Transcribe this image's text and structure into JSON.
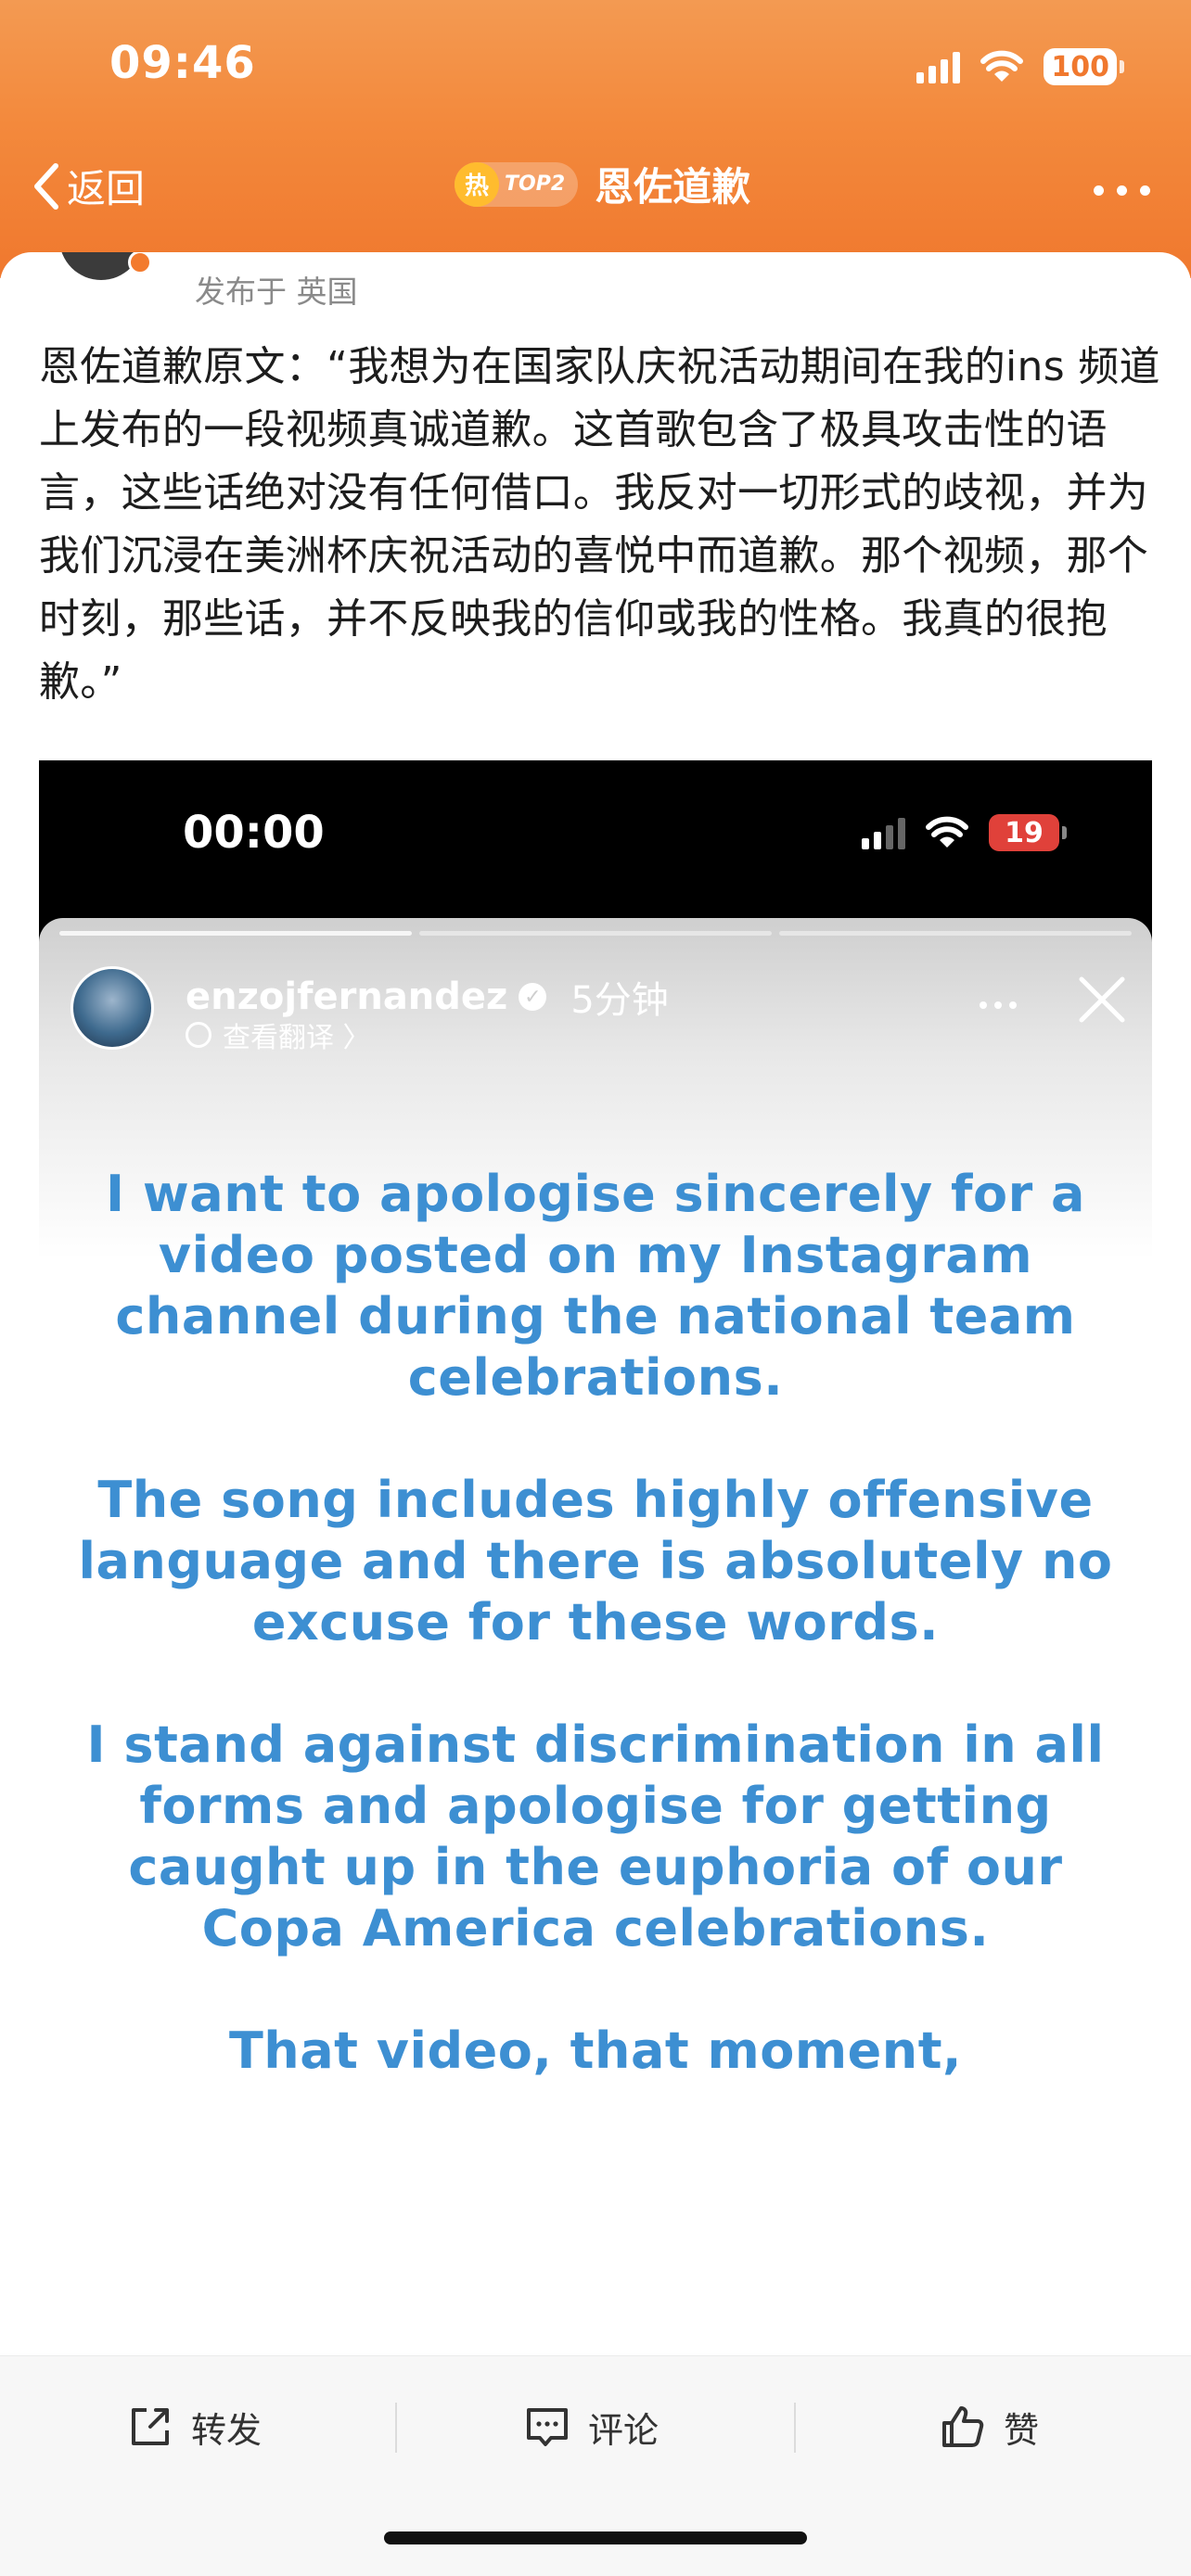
{
  "status_bar": {
    "time": "09:46",
    "battery": "100"
  },
  "nav": {
    "back_label": "返回",
    "badge_hot": "热",
    "badge_rank": "TOP2",
    "title": "恩佐道歉"
  },
  "post": {
    "posted_from": "发布于 英国",
    "text": "恩佐道歉原文：“我想为在国家队庆祝活动期间在我的ins 频道上发布的一段视频真诚道歉。这首歌包含了极具攻击性的语言，这些话绝对没有任何借口。我反对一切形式的歧视，并为我们沉浸在美洲杯庆祝活动的喜悦中而道歉。那个视频，那个时刻，那些话，并不反映我的信仰或我的性格。我真的很抱歉。”"
  },
  "story": {
    "time": "00:00",
    "battery": "19",
    "username": "enzojfernandez",
    "ago": "5分钟",
    "translate_label": "查看翻译 〉",
    "paragraphs": [
      "I want to apologise sincerely for a video posted on my Instagram channel during the national team celebrations.",
      "The song includes highly offensive language and there is absolutely no excuse for these words.",
      "I stand against discrimination in all forms and apologise for getting caught up in the euphoria of our Copa America celebrations.",
      "That video, that moment,"
    ]
  },
  "actions": {
    "forward": "转发",
    "comment": "评论",
    "like": "赞"
  },
  "colors": {
    "header_orange": "#f3893c",
    "story_text_blue": "#3d8fd2",
    "story_battery_red": "#e0413a"
  }
}
